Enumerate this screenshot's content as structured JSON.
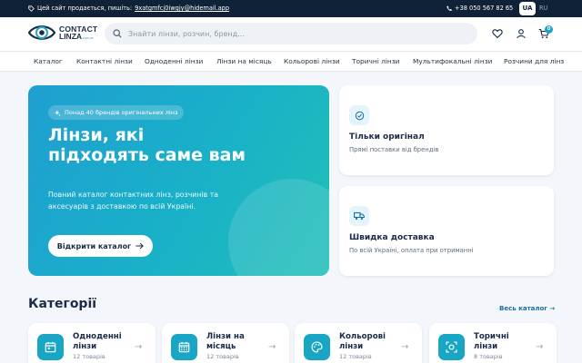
{
  "topbar": {
    "sale_text": "Цей сайт продається, пишіть:",
    "sale_email": "9xatgmfcj0iwgjy@hidemail.app",
    "phone": "+38 050 567 82 65",
    "lang_active": "UA",
    "lang_other": "RU"
  },
  "header": {
    "logo_line1": "CONTACT",
    "logo_line2": "LINZA",
    "logo_domain": ".com.ua",
    "search_placeholder": "Знайти лінзи, розчин, бренд...",
    "cart_count": "0"
  },
  "nav": {
    "items": [
      "Каталог",
      "Контактні лінзи",
      "Одноденні лінзи",
      "Лінзи на місяць",
      "Кольорові лінзи",
      "Торичні лінзи",
      "Мультифокальні лінзи",
      "Розчини для лінз"
    ]
  },
  "hero": {
    "badge": "Понад 40 брендів оригінальних лінз",
    "title": "Лінзи, які підходять саме вам",
    "text": "Повний каталог контактних лінз, розчинів та аксесуарів з доставкою по всій Україні.",
    "cta": "Відкрити каталог"
  },
  "features": [
    {
      "title": "Тільки оригінал",
      "subtitle": "Прямі поставки від брендів",
      "icon": "check-shield-icon"
    },
    {
      "title": "Швидка доставка",
      "subtitle": "По всій Україні, оплата при отриманні",
      "icon": "truck-icon"
    }
  ],
  "categories": {
    "title": "Категорії",
    "all_link": "Весь каталог →",
    "items": [
      {
        "title": "Одноденні лінзи",
        "count": "12 товарів",
        "icon": "calendar-day-icon"
      },
      {
        "title": "Лінзи на місяць",
        "count": "12 товарів",
        "icon": "calendar-month-icon"
      },
      {
        "title": "Кольорові лінзи",
        "count": "12 товарів",
        "icon": "palette-icon"
      },
      {
        "title": "Торичні лінзи",
        "count": "8 товарів",
        "icon": "focus-icon"
      }
    ]
  },
  "colors": {
    "accent": "#19a6c5",
    "dark": "#0f2238",
    "text": "#1b2b45"
  }
}
